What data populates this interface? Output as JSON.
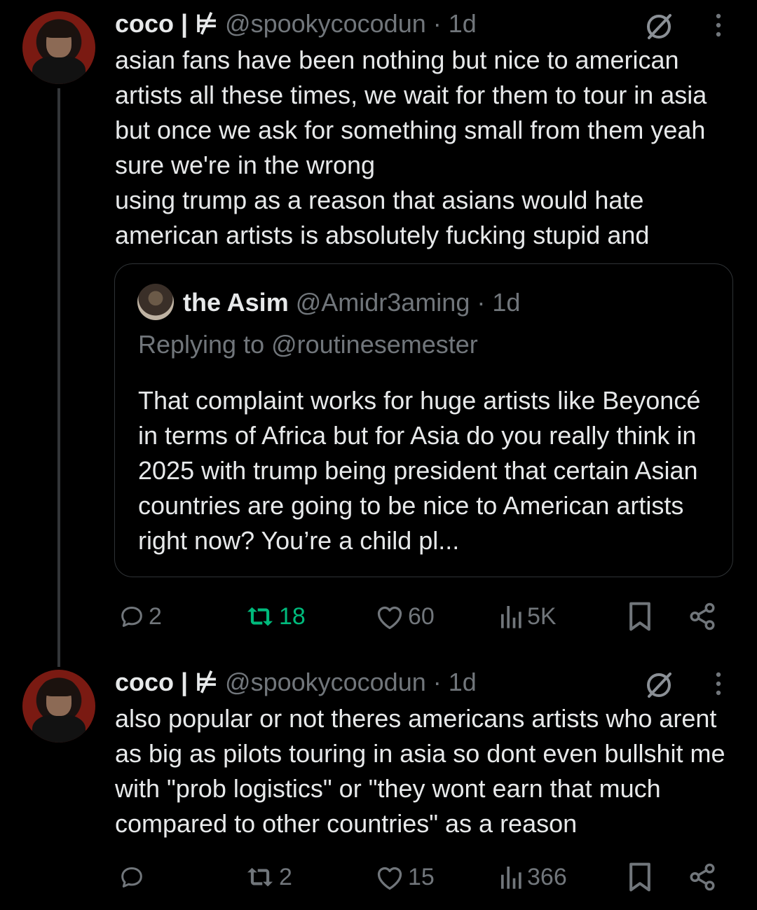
{
  "tweets": [
    {
      "author_name": "coco | ⊭",
      "handle": "@spookycocodun",
      "separator": "·",
      "time": "1d",
      "text": "asian fans have been nothing but nice to american artists all these times, we wait for them to tour in asia but once we ask for something small from them yeah sure we're in the wrong\nusing trump as a reason that asians would hate american artists is absolutely fucking stupid and",
      "quote": {
        "author_name": "the Asim",
        "handle": "@Amidr3aming",
        "separator": "·",
        "time": "1d",
        "replying_to": "Replying to @routinesemester",
        "text": "That complaint works for huge artists like Beyoncé in terms of Africa but for Asia do you really think in 2025 with trump being president that certain Asian countries are going to be nice to American artists right now? You’re a child pl..."
      },
      "replies": "2",
      "reposts": "18",
      "likes": "60",
      "views": "5K"
    },
    {
      "author_name": "coco | ⊭",
      "handle": "@spookycocodun",
      "separator": "·",
      "time": "1d",
      "text": "also popular or not theres americans artists who arent as big as pilots touring in asia so dont even bullshit me with \"prob logistics\" or \"they wont earn that much compared to other countries\" as a reason",
      "replies": "",
      "reposts": "2",
      "likes": "15",
      "views": "366"
    }
  ],
  "colors": {
    "background": "#000000",
    "text": "#e7e9ea",
    "muted": "#71767b",
    "repost_active": "#00ba7c",
    "border": "#2f3336"
  },
  "icons": [
    "reply-icon",
    "repost-icon",
    "like-icon",
    "views-icon",
    "bookmark-icon",
    "share-icon",
    "grok-icon",
    "more-icon"
  ]
}
